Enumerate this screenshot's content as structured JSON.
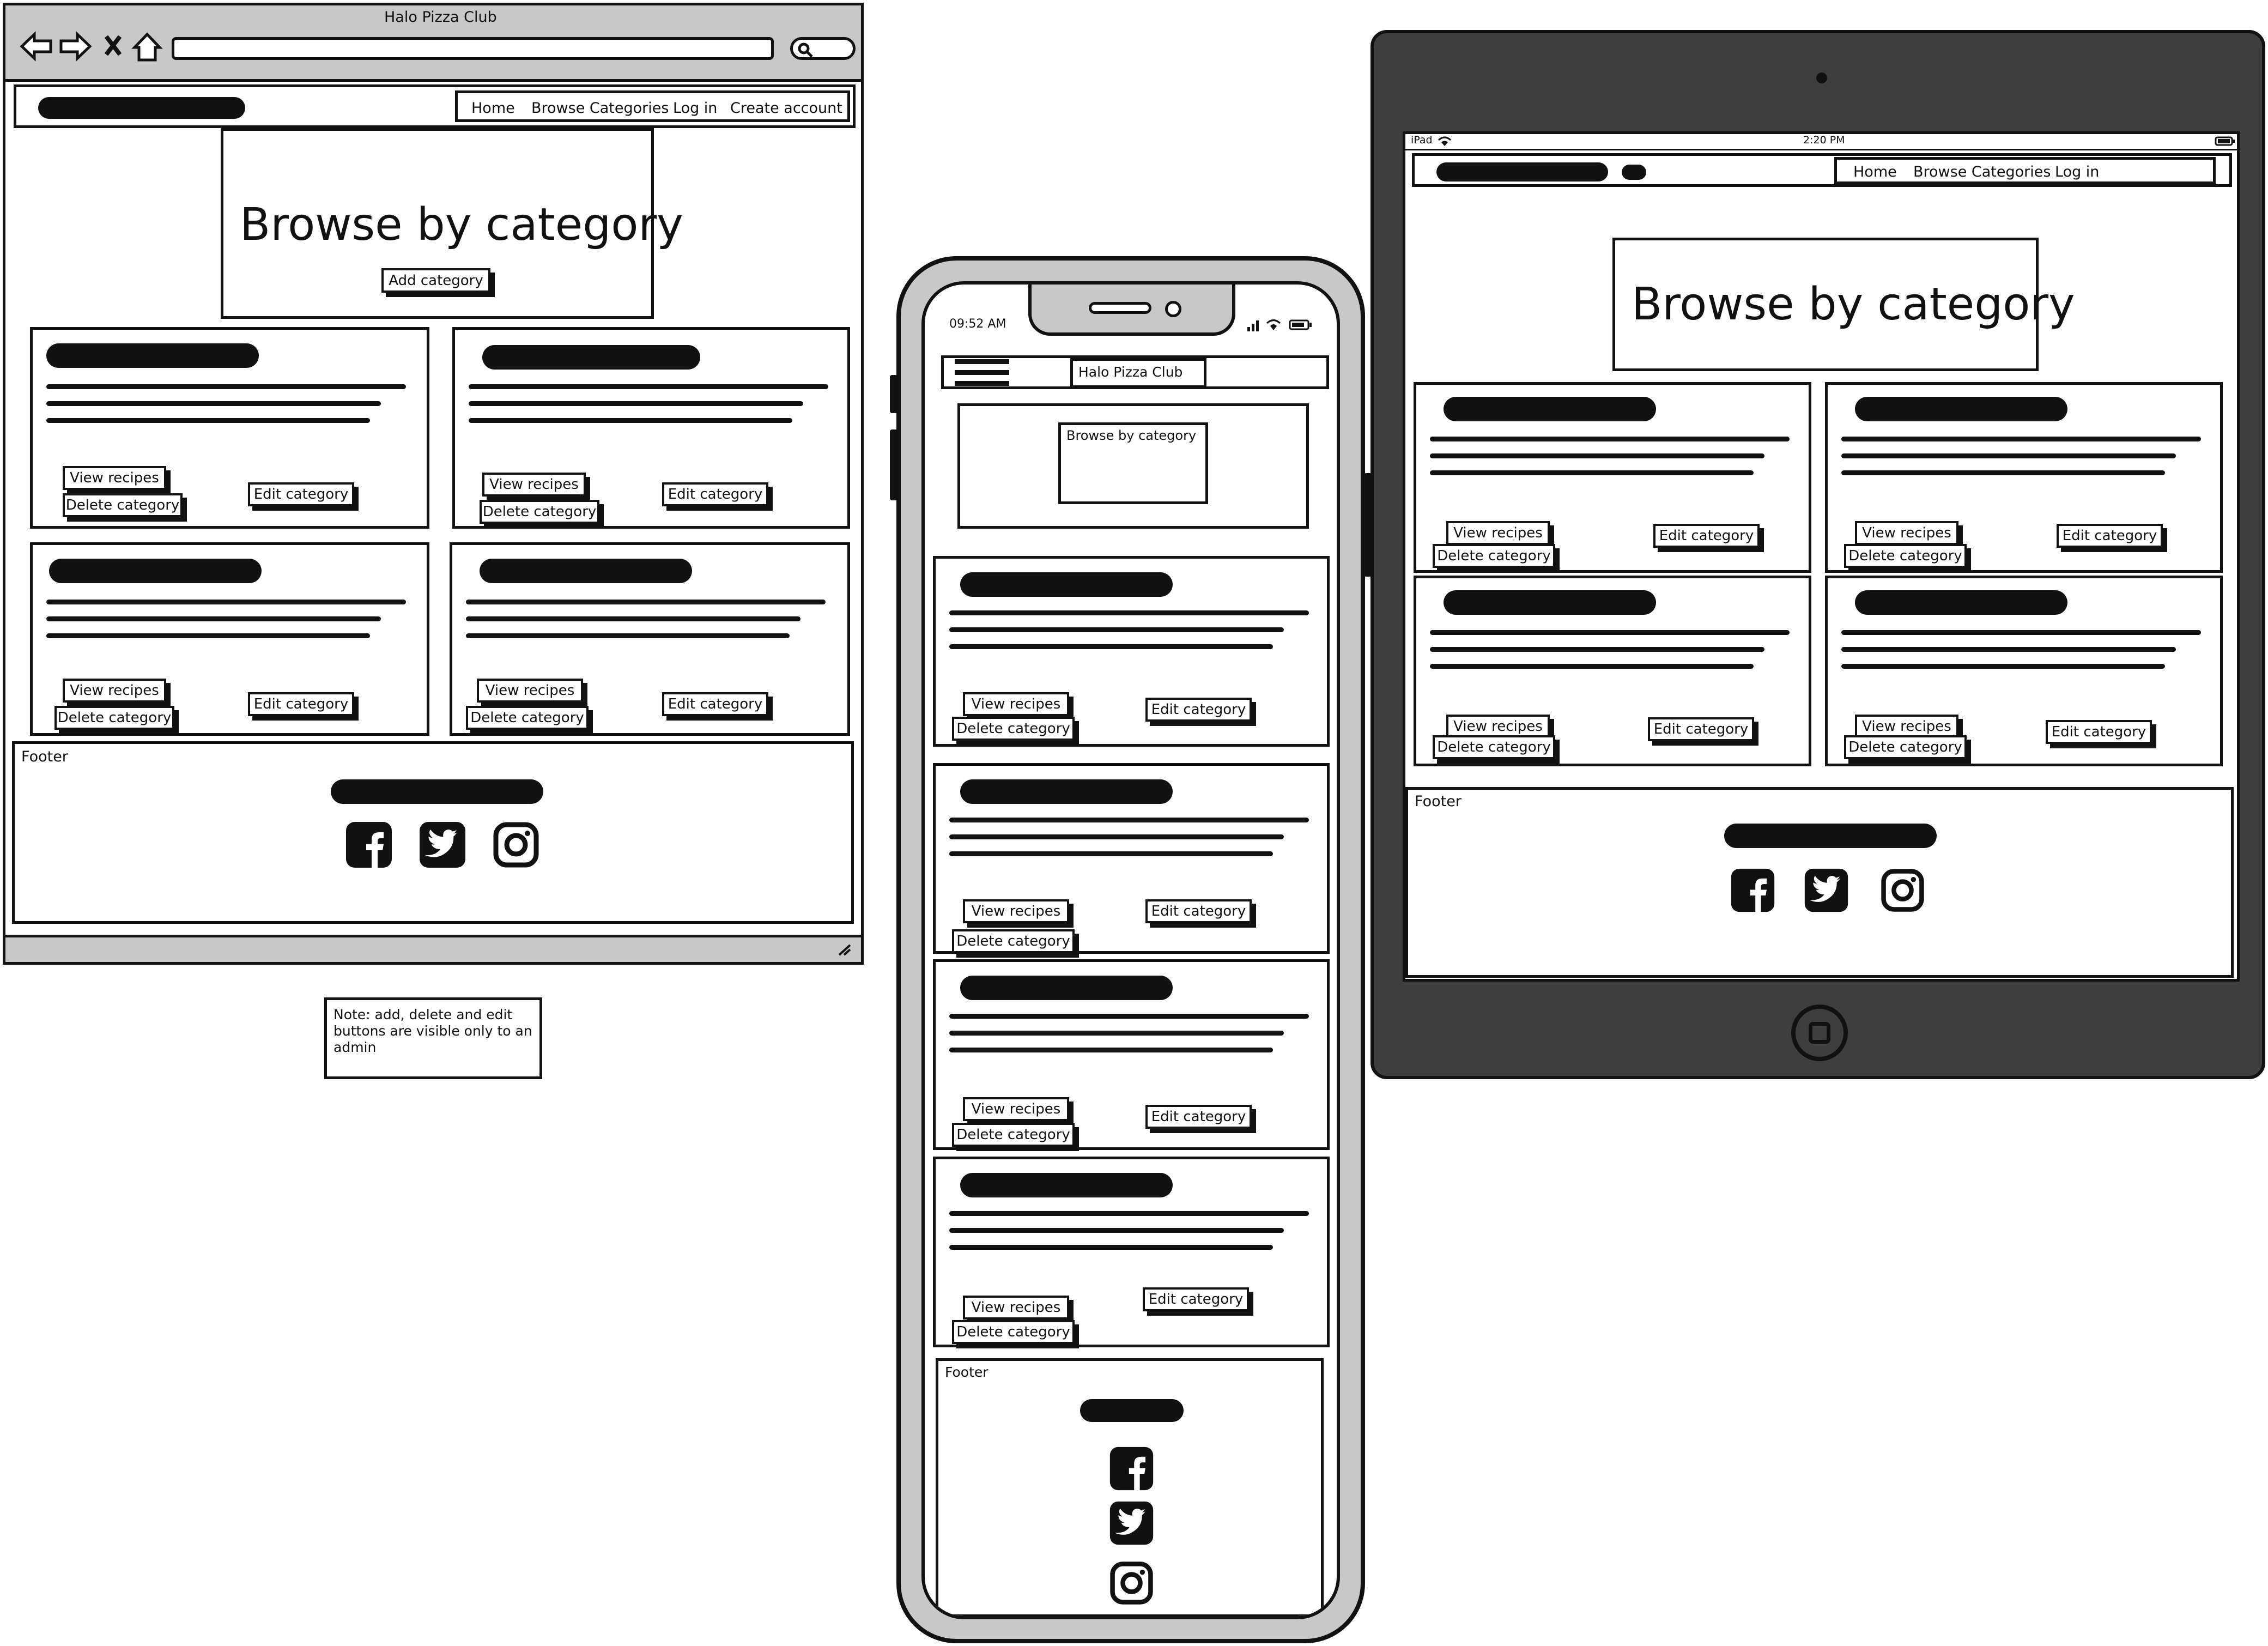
{
  "browser": {
    "title": "Halo Pizza Club",
    "nav": [
      "Home",
      "Browse Categories",
      "Log in",
      "Create account"
    ],
    "hero_title": "Browse by category",
    "add_button": "Add category",
    "footer_label": "Footer"
  },
  "note": {
    "text": "Note: add, delete and edit buttons are visible only to an admin"
  },
  "phone": {
    "time": "09:52 AM",
    "nav_label": "Halo Pizza Club",
    "hero_title": "Browse by category",
    "footer_label": "Footer"
  },
  "tablet": {
    "device_label": "iPad",
    "time": "2:20 PM",
    "nav": [
      "Home",
      "Browse Categories",
      "Log in"
    ],
    "hero_title": "Browse by category",
    "footer_label": "Footer"
  },
  "card": {
    "view_label": "View recipes",
    "delete_label": "Delete category",
    "edit_label": "Edit category"
  },
  "icons": [
    "back-icon",
    "forward-icon",
    "close-icon",
    "home-icon",
    "search-icon",
    "facebook-icon",
    "twitter-icon",
    "instagram-icon",
    "hamburger-icon",
    "wifi-icon",
    "battery-icon",
    "signal-icon",
    "camera-icon",
    "home-button-icon",
    "resize-icon"
  ]
}
